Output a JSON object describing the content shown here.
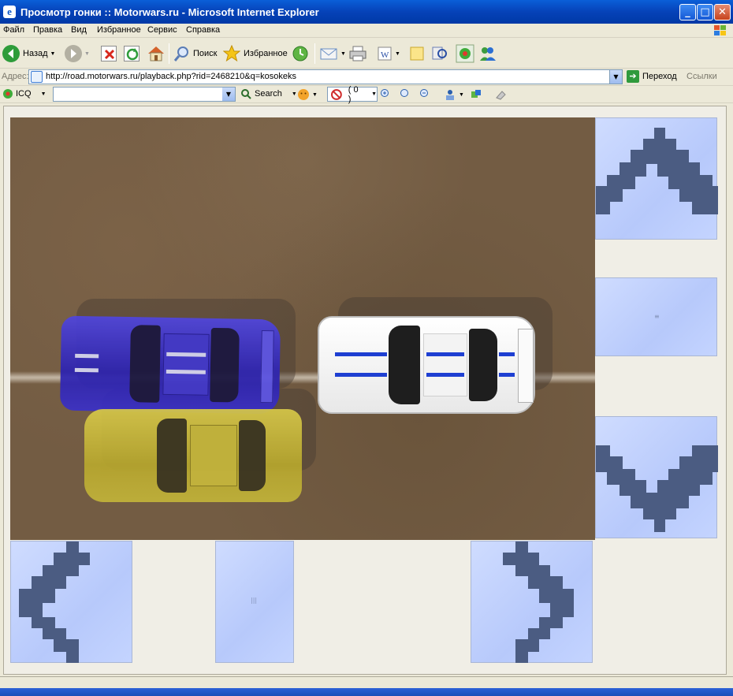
{
  "window": {
    "title": "Просмотр гонки :: Motorwars.ru - Microsoft Internet Explorer",
    "minimize": "_",
    "maximize": "□",
    "close": "✕"
  },
  "menu": [
    "Файл",
    "Правка",
    "Вид",
    "Избранное",
    "Сервис",
    "Справка"
  ],
  "toolbar": {
    "back_label": "Назад",
    "search_label": "Поиск",
    "favorites_label": "Избранное"
  },
  "address": {
    "label": "Адрес:",
    "url": "http://road.motorwars.ru/playback.php?rid=2468210&q=kosokeks",
    "go_label": "Переход",
    "links_label": "Ссылки"
  },
  "icq": {
    "label": "ICQ",
    "search_label": "Search",
    "counter": "( 0 )"
  },
  "race": {
    "cars": [
      {
        "name": "blue-car",
        "color": "#3a33c7"
      },
      {
        "name": "white-car",
        "color": "#f6f6f6"
      },
      {
        "name": "yellow-car",
        "color": "#c6b73e"
      }
    ],
    "controls": [
      "up-arrow",
      "center",
      "down-arrow",
      "left-arrow",
      "pause",
      "right-arrow"
    ]
  },
  "colors": {
    "ground": "#735c43",
    "tile": "#c4d4ff",
    "arrow": "#4b5c82"
  }
}
